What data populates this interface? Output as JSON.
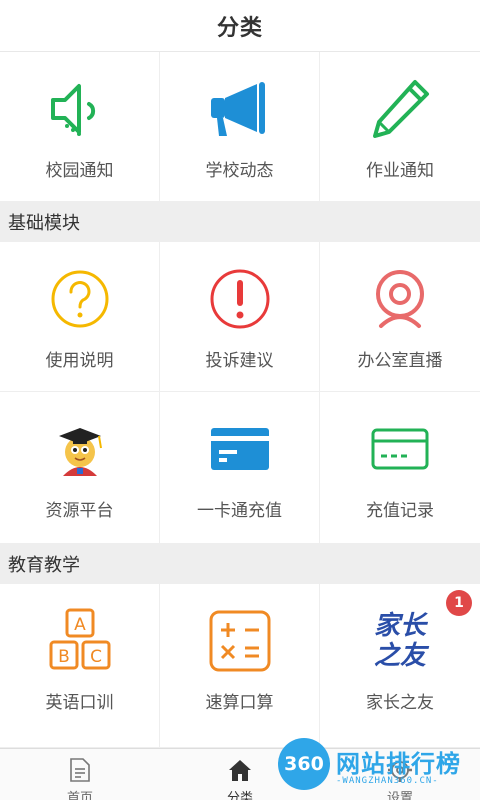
{
  "header": {
    "title": "分类"
  },
  "row1": [
    {
      "label": "校园通知",
      "icon": "speaker-icon"
    },
    {
      "label": "学校动态",
      "icon": "megaphone-icon"
    },
    {
      "label": "作业通知",
      "icon": "pencil-icon"
    }
  ],
  "section_basic": {
    "title": "基础模块"
  },
  "row2": [
    {
      "label": "使用说明",
      "icon": "question-icon"
    },
    {
      "label": "投诉建议",
      "icon": "exclamation-icon"
    },
    {
      "label": "办公室直播",
      "icon": "webcam-icon"
    }
  ],
  "row3": [
    {
      "label": "资源平台",
      "icon": "graduate-mascot-icon"
    },
    {
      "label": "一卡通充值",
      "icon": "card-icon"
    },
    {
      "label": "充值记录",
      "icon": "card-outline-icon"
    }
  ],
  "section_edu": {
    "title": "教育教学"
  },
  "row4": [
    {
      "label": "英语口训",
      "icon": "abc-blocks-icon"
    },
    {
      "label": "速算口算",
      "icon": "calculator-icon"
    },
    {
      "label": "家长之友",
      "icon": "parent-logo-icon",
      "logo_text_top": "家长",
      "logo_text_bottom": "之友",
      "badge": "1"
    }
  ],
  "bottom_nav": [
    {
      "label": "首页",
      "icon": "document-icon"
    },
    {
      "label": "分类",
      "icon": "home-icon",
      "active": true
    },
    {
      "label": "设置",
      "icon": "gear-icon"
    }
  ],
  "watermark": {
    "logo": "360",
    "title": "网站排行榜",
    "subtitle": "-WANGZHAN360.CN-"
  },
  "colors": {
    "green": "#22b256",
    "blue": "#1e8fd6",
    "yellow": "#f5b800",
    "red": "#e83a3a",
    "salmon": "#e86a6a",
    "orange": "#f08a24",
    "navy": "#2a4ea8"
  }
}
